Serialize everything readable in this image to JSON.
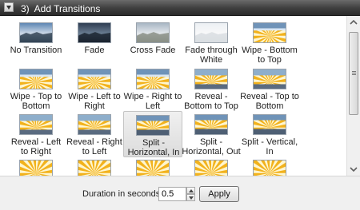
{
  "header": {
    "title": "3)  Add Transitions",
    "collapse_icon": "triangle-collapse-icon"
  },
  "transitions": [
    {
      "label": "No Transition",
      "thumb": "landscape-no-transition"
    },
    {
      "label": "Fade",
      "thumb": "landscape-dark-fade"
    },
    {
      "label": "Cross Fade",
      "thumb": "landscape-cross-fade"
    },
    {
      "label": "Fade through White",
      "thumb": "landscape-white-fade"
    },
    {
      "label": "Wipe - Bottom to Top",
      "thumb": "sunburst-wipe"
    },
    {
      "label": "Wipe - Top to Bottom",
      "thumb": "sunburst-wipe"
    },
    {
      "label": "Wipe - Left to Right",
      "thumb": "sunburst-wipe"
    },
    {
      "label": "Wipe - Right to Left",
      "thumb": "sunburst-wipe"
    },
    {
      "label": "Reveal - Bottom to Top",
      "thumb": "sunburst-reveal"
    },
    {
      "label": "Reveal - Top to Bottom",
      "thumb": "sunburst-reveal"
    },
    {
      "label": "Reveal - Left to Right",
      "thumb": "sunburst-reveal"
    },
    {
      "label": "Reveal - Right to Left",
      "thumb": "sunburst-reveal"
    },
    {
      "label": "Split - Horizontal, In",
      "thumb": "sunburst-split",
      "selected": true
    },
    {
      "label": "Split - Horizontal, Out",
      "thumb": "sunburst-split"
    },
    {
      "label": "Split - Vertical, In",
      "thumb": "sunburst-split"
    },
    {
      "label": "",
      "thumb": "sunburst-partial"
    },
    {
      "label": "",
      "thumb": "sunburst-partial"
    },
    {
      "label": "",
      "thumb": "sunburst-partial"
    },
    {
      "label": "",
      "thumb": "sunburst-partial"
    },
    {
      "label": "",
      "thumb": "sunburst-partial"
    }
  ],
  "footer": {
    "duration_label": "Duration in seconds:",
    "duration_value": "0.5",
    "apply_label": "Apply"
  },
  "colors": {
    "header_bg": "#3e3e3e",
    "sun_yellow": "#f2b21c",
    "sky_blue": "#6f93b8"
  }
}
